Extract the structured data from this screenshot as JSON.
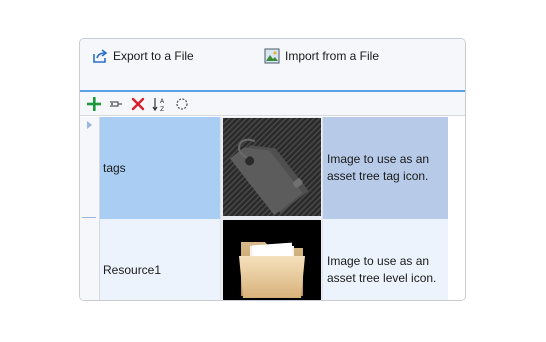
{
  "actions": {
    "export_label": "Export to a File",
    "import_label": "Import from a File"
  },
  "toolbar": {
    "add_icon": "plus-icon",
    "assign_icon": "link-icon",
    "delete_icon": "delete-x-icon",
    "sort_icon": "sort-az-icon",
    "refresh_icon": "refresh-icon"
  },
  "colors": {
    "accent_rule": "#5aa2e6",
    "selected_name_cell": "#a9cdf3",
    "selected_desc_cell": "#b7cbe8",
    "row_background": "#edf3fc",
    "add_green": "#1a9a3a",
    "delete_red": "#d6202a"
  },
  "rows": [
    {
      "name": "tags",
      "image": "tag-icon",
      "description": "Image to use as an asset tree tag icon."
    },
    {
      "name": "Resource1",
      "image": "folder-icon",
      "description": "Image to use as an asset tree level icon."
    }
  ]
}
